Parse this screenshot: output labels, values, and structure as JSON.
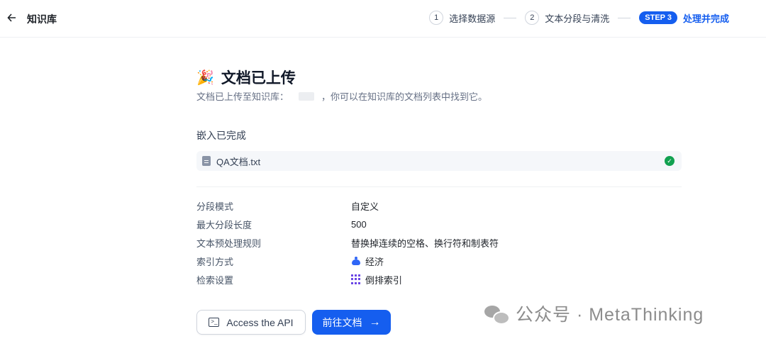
{
  "header": {
    "back_icon": "arrow-left-icon",
    "title": "知识库",
    "steps": [
      {
        "num": "1",
        "label": "选择数据源"
      },
      {
        "num": "2",
        "label": "文本分段与清洗"
      },
      {
        "badge": "STEP 3",
        "label": "处理并完成"
      }
    ]
  },
  "main": {
    "title_icon": "party-popper",
    "title": "文档已上传",
    "subtitle_prefix": "文档已上传至知识库：",
    "subtitle_suffix": "，你可以在知识库的文档列表中找到它。",
    "embed_title": "嵌入已完成",
    "file": {
      "name": "QA文档.txt",
      "status_icon": "check-circle-icon"
    },
    "info": [
      {
        "label": "分段模式",
        "value": "自定义"
      },
      {
        "label": "最大分段长度",
        "value": "500"
      },
      {
        "label": "文本预处理规则",
        "value": "替换掉连续的空格、换行符和制表符"
      },
      {
        "label": "索引方式",
        "value": "经济",
        "icon": "piggy-bank-icon"
      },
      {
        "label": "检索设置",
        "value": "倒排索引",
        "icon": "grid-icon"
      }
    ]
  },
  "buttons": {
    "api": "Access the API",
    "docs": "前往文档"
  },
  "watermark": "公众号 · MetaThinking",
  "colors": {
    "primary": "#155eef",
    "success": "#12a150"
  }
}
